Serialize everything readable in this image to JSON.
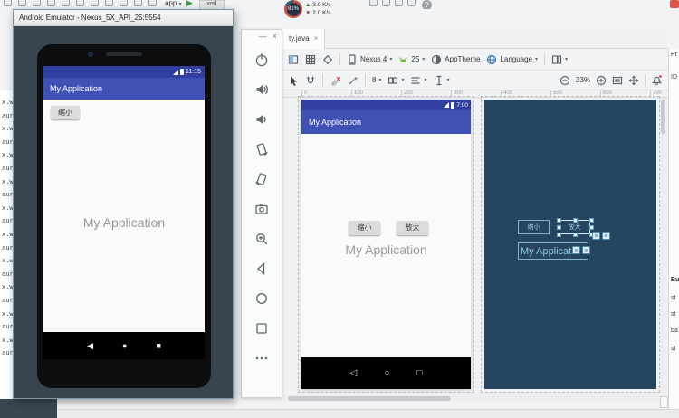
{
  "icons": {
    "caret": "▾",
    "close": "×",
    "minimize": "—",
    "run": "▶",
    "help": "?",
    "up_arrow": "▲",
    "down_arrow": "▼",
    "back_nav": "◀",
    "home_nav": "●",
    "recents_nav": "■",
    "back_outline": "◁",
    "home_outline": "○",
    "recents_outline": "□"
  },
  "top_bar": {
    "run_config": "app",
    "xml_tab": "xml"
  },
  "overlay": {
    "percent": "81%",
    "up_speed": "3.0 K/s",
    "down_speed": "2.0 K/s"
  },
  "emulator": {
    "title": "Android Emulator - Nexus_5X_API_25:5554",
    "status_time": "11:15",
    "app_bar_title": "My Application",
    "shrink_button": "缩小",
    "center_text": "My Application"
  },
  "ide": {
    "editor_tab": "ty.java",
    "code_lines": [
      "x.w",
      "aur",
      "x.w",
      "aur",
      "x.w",
      "aur",
      "x.w",
      "aur",
      "x.w",
      "aur",
      "x.w",
      "aur",
      "x.w",
      "aur",
      "x.w",
      "aur",
      "x.w",
      "aur",
      "x.w",
      "aur"
    ],
    "toolbar": {
      "device": "Nexus 4",
      "api_level": "25",
      "theme": "AppTheme",
      "language": "Language",
      "default_margin": "8",
      "zoom_level": "33%"
    },
    "ruler_labels": [
      "0",
      "100",
      "200",
      "300",
      "400",
      "500",
      "600",
      "700"
    ],
    "design": {
      "status_time": "7:00",
      "app_bar_title": "My Application",
      "shrink_button": "缩小",
      "enlarge_button": "放大",
      "center_text": "My Application"
    },
    "blueprint": {
      "shrink_button": "缩小",
      "enlarge_button": "放大",
      "text_label": "My Applicati"
    },
    "properties_panel": {
      "title": "Pr",
      "rows": [
        "ID",
        "Bu",
        "st",
        "st",
        "ba",
        "st"
      ]
    }
  }
}
